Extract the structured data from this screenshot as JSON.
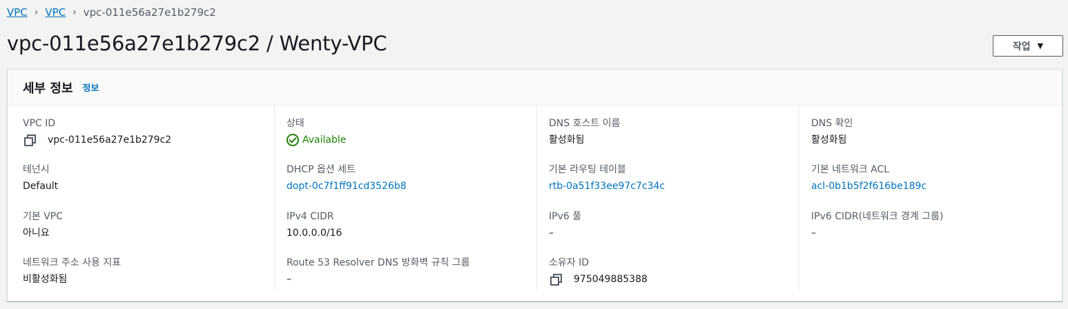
{
  "breadcrumb": {
    "items": [
      "VPC",
      "VPC"
    ],
    "current": "vpc-011e56a27e1b279c2",
    "separator": "›"
  },
  "page": {
    "title": "vpc-011e56a27e1b279c2 / Wenty-VPC",
    "actions_label": "작업",
    "actions_caret": "▼"
  },
  "details": {
    "title": "세부 정보",
    "info_link": "정보",
    "columns": [
      [
        {
          "label": "VPC ID",
          "value": "vpc-011e56a27e1b279c2"
        },
        {
          "label": "테넌시",
          "value": "Default"
        },
        {
          "label": "기본 VPC",
          "value": "아니요"
        },
        {
          "label": "네트워크 주소 사용 지표",
          "value": "비활성화됨"
        }
      ],
      [
        {
          "label": "상태",
          "value": "Available"
        },
        {
          "label": "DHCP 옵션 세트",
          "value": "dopt-0c7f1ff91cd3526b8"
        },
        {
          "label": "IPv4 CIDR",
          "value": "10.0.0.0/16"
        },
        {
          "label": "Route 53 Resolver DNS 방화벽 규칙 그룹",
          "value": "–"
        }
      ],
      [
        {
          "label": "DNS 호스트 이름",
          "value": "활성화됨"
        },
        {
          "label": "기본 라우팅 테이블",
          "value": "rtb-0a51f33ee97c7c34c"
        },
        {
          "label": "IPv6 풀",
          "value": "–"
        },
        {
          "label": "소유자 ID",
          "value": "975049885388"
        }
      ],
      [
        {
          "label": "DNS 확인",
          "value": "활성화됨"
        },
        {
          "label": "기본 네트워크 ACL",
          "value": "acl-0b1b5f2f616be189c"
        },
        {
          "label": "IPv6 CIDR(네트워크 경계 그룹)",
          "value": "–"
        }
      ]
    ]
  },
  "colors": {
    "link": "#0073bb",
    "status_ok": "#1d8102",
    "text": "#16191f",
    "label": "#545b64",
    "background": "#f2f3f3"
  }
}
